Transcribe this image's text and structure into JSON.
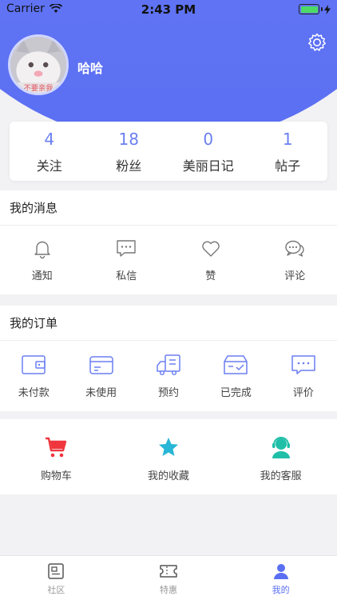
{
  "status_bar": {
    "carrier": "Carrier",
    "time": "2:43 PM"
  },
  "profile": {
    "username": "哈哈",
    "avatar_caption": "不要亲我"
  },
  "stats": [
    {
      "value": "4",
      "label": "关注"
    },
    {
      "value": "18",
      "label": "粉丝"
    },
    {
      "value": "0",
      "label": "美丽日记"
    },
    {
      "value": "1",
      "label": "帖子"
    }
  ],
  "messages": {
    "title": "我的消息",
    "items": [
      {
        "label": "通知",
        "icon": "bell-icon"
      },
      {
        "label": "私信",
        "icon": "message-icon"
      },
      {
        "label": "赞",
        "icon": "heart-icon"
      },
      {
        "label": "评论",
        "icon": "comment-icon"
      }
    ]
  },
  "orders": {
    "title": "我的订单",
    "items": [
      {
        "label": "未付款",
        "icon": "wallet-icon"
      },
      {
        "label": "未使用",
        "icon": "card-icon"
      },
      {
        "label": "预约",
        "icon": "delivery-truck-icon"
      },
      {
        "label": "已完成",
        "icon": "completed-box-icon"
      },
      {
        "label": "评价",
        "icon": "review-icon"
      }
    ]
  },
  "services": {
    "items": [
      {
        "label": "购物车",
        "icon": "shopping-cart-icon"
      },
      {
        "label": "我的收藏",
        "icon": "star-icon"
      },
      {
        "label": "我的客服",
        "icon": "customer-service-icon"
      }
    ]
  },
  "tabbar": {
    "items": [
      {
        "label": "社区",
        "icon": "community-icon"
      },
      {
        "label": "特惠",
        "icon": "ticket-icon"
      },
      {
        "label": "我的",
        "icon": "user-icon"
      }
    ],
    "active": "我的"
  },
  "colors": {
    "accent": "#5b6ff3",
    "stat_number": "#6b7ff2",
    "cart": "#f0363d",
    "star": "#27b6d6",
    "service": "#1fbfa8",
    "battery": "#4cd964"
  }
}
